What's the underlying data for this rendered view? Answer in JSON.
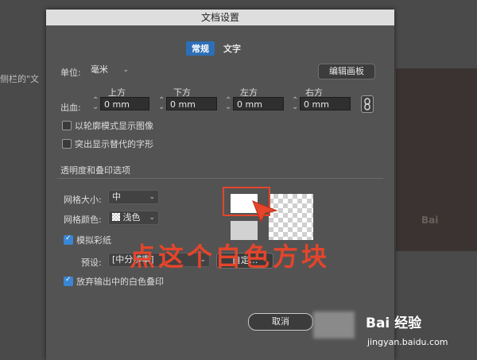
{
  "background": {
    "snippet": "侧栏的\"文"
  },
  "dialog": {
    "title": "文档设置",
    "tabs": [
      {
        "label": "常规"
      },
      {
        "label": "文字"
      }
    ],
    "units": {
      "label": "单位:",
      "value": "毫米"
    },
    "edit_artboards_label": "编辑画板",
    "bleed": {
      "label": "出血:",
      "top": {
        "label": "上方",
        "value": "0 mm"
      },
      "bottom": {
        "label": "下方",
        "value": "0 mm"
      },
      "left": {
        "label": "左方",
        "value": "0 mm"
      },
      "right": {
        "label": "右方",
        "value": "0 mm"
      }
    },
    "checkbox_outline": "以轮廓模式显示图像",
    "checkbox_substituted": "突出显示替代的字形",
    "transparency_section": "透明度和叠印选项",
    "grid_size": {
      "label": "网格大小:",
      "value": "中"
    },
    "grid_color": {
      "label": "网格颜色:",
      "value": "浅色"
    },
    "simulate_paper": "模拟彩纸",
    "preset": {
      "label": "预设:",
      "value": "[中分辨率]"
    },
    "custom_button": "自定...",
    "discard_white_overprint": "放弃输出中的白色叠印",
    "cancel_label": "取消"
  },
  "annotation": {
    "text": "点这个白色方块"
  },
  "watermark": {
    "brand": "Bai 经验",
    "url": "jingyan.baidu.com"
  },
  "colors": {
    "accent": "#2d6fb6",
    "annotation": "#e4452b"
  }
}
